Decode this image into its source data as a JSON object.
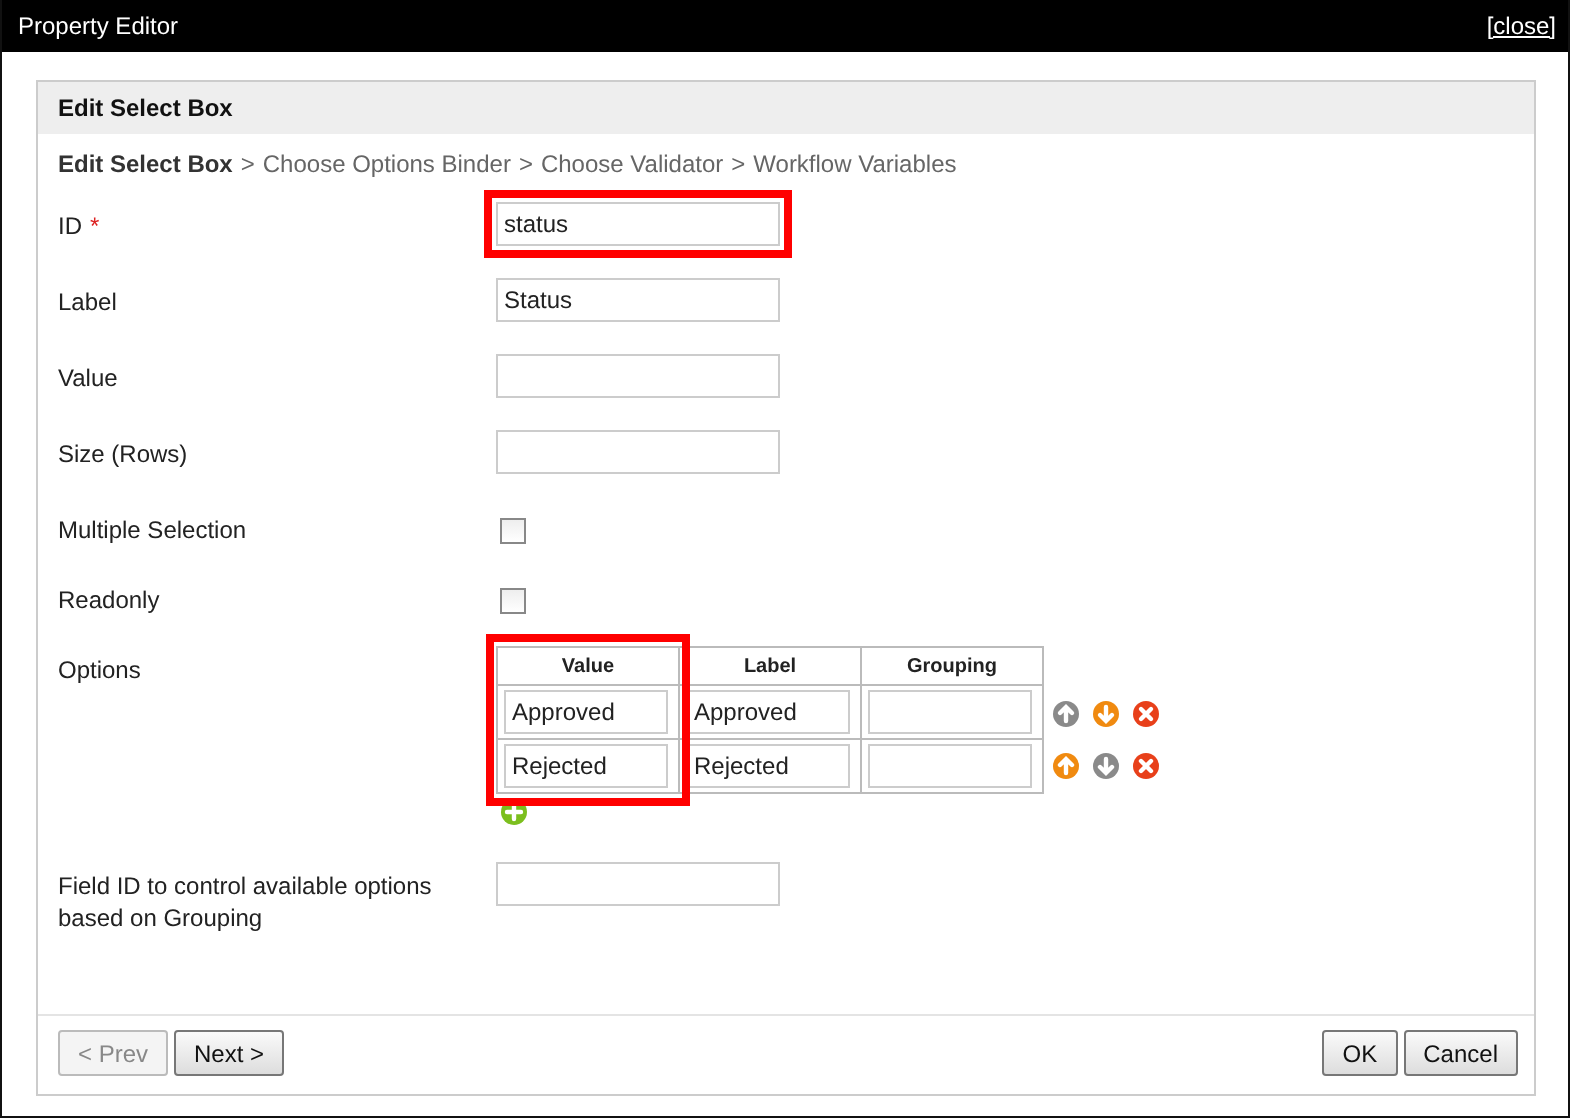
{
  "window": {
    "title": "Property Editor",
    "close_link": "[close]"
  },
  "panel": {
    "title": "Edit Select Box"
  },
  "breadcrumb": {
    "separator": ">",
    "steps": [
      {
        "label": "Edit Select Box",
        "selected": true
      },
      {
        "label": "Choose Options Binder",
        "selected": false
      },
      {
        "label": "Choose Validator",
        "selected": false
      },
      {
        "label": "Workflow Variables",
        "selected": false
      }
    ]
  },
  "fields": [
    {
      "kind": "text",
      "label": "ID",
      "required_mark": "*",
      "value": "status",
      "highlighted": true
    },
    {
      "kind": "text",
      "label": "Label",
      "value": "Status",
      "highlighted": false
    },
    {
      "kind": "text",
      "label": "Value",
      "highlighted": false
    },
    {
      "kind": "text",
      "label": "Size (Rows)",
      "highlighted": false
    },
    {
      "kind": "checkbox",
      "label": "Multiple Selection",
      "checked": false
    },
    {
      "kind": "checkbox",
      "label": "Readonly",
      "checked": false
    },
    {
      "kind": "options",
      "label": "Options",
      "columns": [
        {
          "label": "Value",
          "highlighted": true
        },
        {
          "label": "Label",
          "highlighted": false
        },
        {
          "label": "Grouping",
          "highlighted": false
        }
      ],
      "rows": [
        {
          "value": "Approved",
          "label": "Approved",
          "can_move_up": false,
          "can_move_down": true
        },
        {
          "value": "Rejected",
          "label": "Rejected",
          "can_move_up": true,
          "can_move_down": false
        }
      ]
    },
    {
      "kind": "text",
      "label": "Field ID to control available options based on Grouping",
      "highlighted": false
    }
  ],
  "footer": {
    "nav_buttons": [
      {
        "label": "< Prev",
        "disabled": true
      },
      {
        "label": "Next >",
        "disabled": false
      }
    ],
    "action_buttons": [
      {
        "label": "OK"
      },
      {
        "label": "Cancel"
      }
    ]
  }
}
